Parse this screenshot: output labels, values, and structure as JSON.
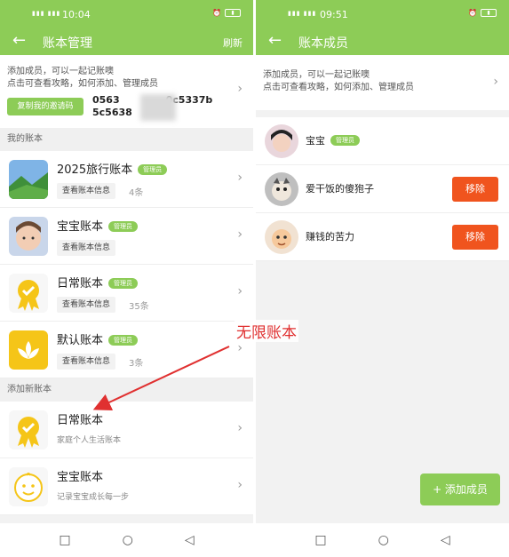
{
  "left": {
    "status_time": "10:04",
    "nav": {
      "title": "账本管理",
      "action": "刷新"
    },
    "tip": {
      "line1": "添加成员，可以一起记账噢",
      "line2": "点击可查看攻略，如何添加、管理成员",
      "invite_button": "复制我的邀请码",
      "code_line1": "0563",
      "code_line1_tail": "0c5337b",
      "code_line2": "5c5638"
    },
    "my_books_label": "我的账本",
    "books": [
      {
        "name": "2025旅行账本",
        "badge": "管理员",
        "info": "查看账本信息",
        "count": "4条",
        "thumb": "landscape-photo"
      },
      {
        "name": "宝宝账本",
        "badge": "管理员",
        "info": "查看账本信息",
        "count": "",
        "thumb": "baby-photo"
      },
      {
        "name": "日常账本",
        "badge": "管理员",
        "info": "查看账本信息",
        "count": "35条",
        "thumb": "medal-icon"
      },
      {
        "name": "默认账本",
        "badge": "管理员",
        "info": "查看账本信息",
        "count": "3条",
        "thumb": "lotus-icon"
      }
    ],
    "add_books_label": "添加新账本",
    "new_books": [
      {
        "name": "日常账本",
        "desc": "家庭个人生活账本",
        "thumb": "medal-icon"
      },
      {
        "name": "宝宝账本",
        "desc": "记录宝宝成长每一步",
        "thumb": "baby-face-icon"
      }
    ]
  },
  "right": {
    "status_time": "09:51",
    "nav": {
      "title": "账本成员"
    },
    "tip": {
      "line1": "添加成员，可以一起记账噢",
      "line2": "点击可查看攻略，如何添加、管理成员"
    },
    "members": [
      {
        "name": "宝宝",
        "badge": "管理员",
        "remove": ""
      },
      {
        "name": "爱干饭的傻狍子",
        "badge": "",
        "remove": "移除"
      },
      {
        "name": "赚钱的苦力",
        "badge": "",
        "remove": "移除"
      }
    ],
    "add_member": "+ 添加成员"
  },
  "annotation": "无限账本",
  "colors": {
    "green": "#8dcc57",
    "red_button": "#f0541e",
    "annotation": "#e03030"
  }
}
